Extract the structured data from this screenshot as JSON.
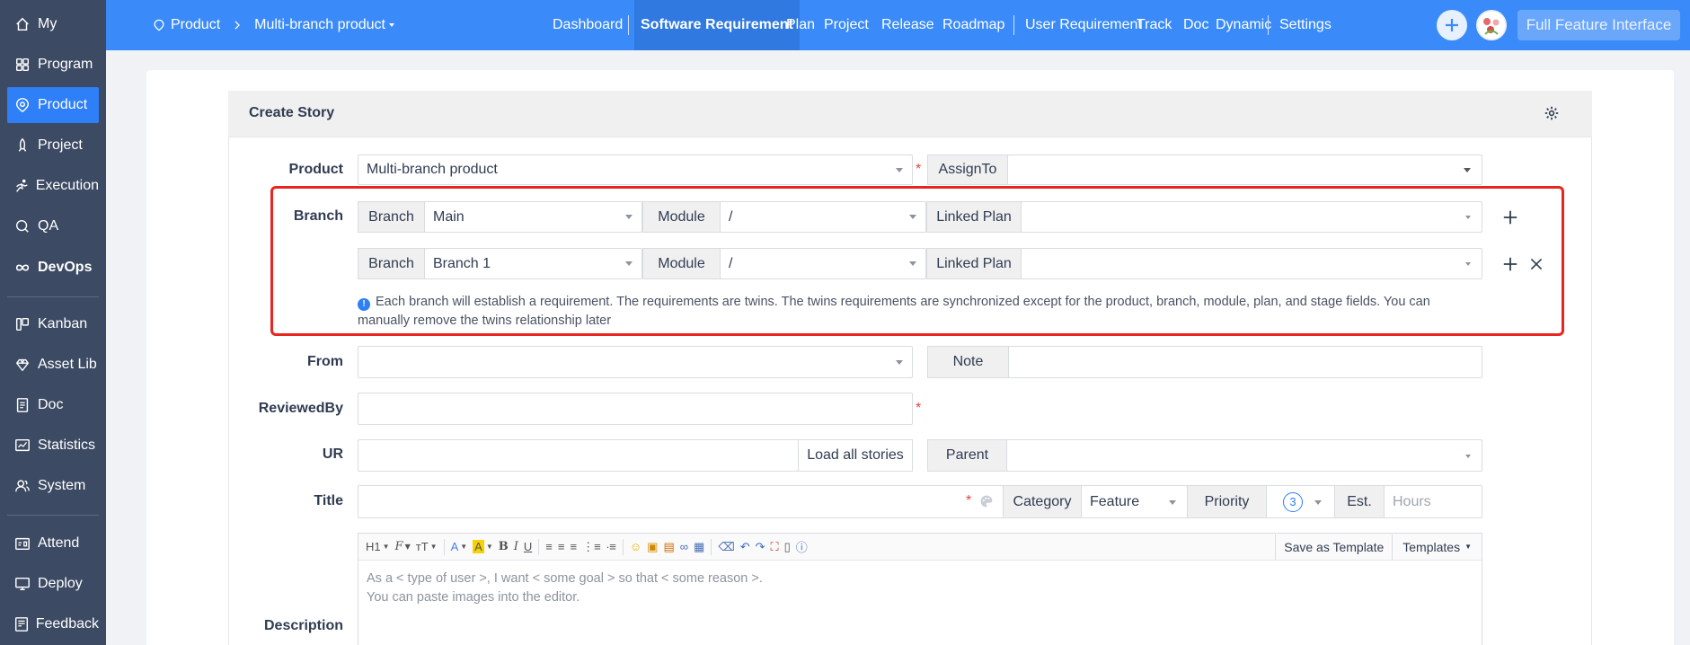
{
  "sidebar": {
    "items": [
      {
        "label": "My",
        "icon": "home-icon"
      },
      {
        "label": "Program",
        "icon": "grid-icon"
      },
      {
        "label": "Product",
        "icon": "product-icon",
        "active": true
      },
      {
        "label": "Project",
        "icon": "rocket-icon"
      },
      {
        "label": "Execution",
        "icon": "run-icon"
      },
      {
        "label": "QA",
        "icon": "search-icon"
      },
      {
        "label": "DevOps",
        "icon": "infinity-icon"
      },
      {
        "label": "Kanban",
        "icon": "kanban-icon"
      },
      {
        "label": "Asset Lib",
        "icon": "diamond-icon"
      },
      {
        "label": "Doc",
        "icon": "doc-icon"
      },
      {
        "label": "Statistics",
        "icon": "statistics-icon"
      },
      {
        "label": "System",
        "icon": "users-icon"
      },
      {
        "label": "Attend",
        "icon": "attend-icon"
      },
      {
        "label": "Deploy",
        "icon": "deploy-icon"
      },
      {
        "label": "Feedback",
        "icon": "feedback-icon"
      }
    ]
  },
  "header": {
    "breadcrumb_root": "Product",
    "breadcrumb_current": "Multi-branch product",
    "nav": {
      "dashboard": "Dashboard",
      "software_requirement": "Software Requirement",
      "plan": "Plan",
      "project": "Project",
      "release": "Release",
      "roadmap": "Roadmap",
      "user_requirement": "User Requirement",
      "track": "Track",
      "doc": "Doc",
      "dynamic": "Dynamic",
      "settings": "Settings"
    },
    "full_feature_label": "Full Feature Interface"
  },
  "form": {
    "title": "Create Story",
    "product": {
      "label": "Product",
      "value": "Multi-branch product"
    },
    "assign_to": {
      "label": "AssignTo",
      "value": ""
    },
    "branch": {
      "label": "Branch",
      "rows": [
        {
          "branch_label": "Branch",
          "branch_value": "Main",
          "module_label": "Module",
          "module_value": "/",
          "plan_label": "Linked Plan",
          "plan_value": ""
        },
        {
          "branch_label": "Branch",
          "branch_value": "Branch 1",
          "module_label": "Module",
          "module_value": "/",
          "plan_label": "Linked Plan",
          "plan_value": ""
        }
      ],
      "tip": "Each branch will establish a requirement. The requirements are twins. The twins requirements are synchronized except for the product, branch, module, plan, and stage fields. You can manually remove the twins relationship later"
    },
    "from": {
      "label": "From",
      "value": ""
    },
    "note": {
      "label": "Note",
      "value": ""
    },
    "reviewed_by": {
      "label": "ReviewedBy",
      "value": ""
    },
    "ur": {
      "label": "UR",
      "value": "",
      "load_all": "Load all stories"
    },
    "parent": {
      "label": "Parent",
      "value": ""
    },
    "title_field": {
      "label": "Title",
      "value": ""
    },
    "category": {
      "label": "Category",
      "value": "Feature"
    },
    "priority": {
      "label": "Priority",
      "value": "3"
    },
    "estimate": {
      "label": "Est.",
      "placeholder": "Hours"
    },
    "description": {
      "label": "Description",
      "placeholder_line1": "As a < type of user >, I want < some goal > so that < some reason >.",
      "placeholder_line2": "You can paste images into the editor.",
      "toolbar": {
        "h1": "H1",
        "save_template": "Save as Template",
        "templates": "Templates"
      }
    }
  },
  "colors": {
    "accent": "#3a8bf9",
    "sidebar": "#3c4a63",
    "highlight": "#e8251f",
    "required": "#e8443b"
  }
}
